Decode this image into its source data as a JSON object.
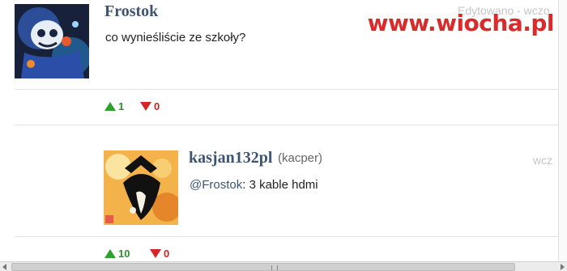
{
  "watermark": "www.wiocha.pl",
  "comments": [
    {
      "username": "Frostok",
      "text": "co wynieśliście ze szkoły?",
      "edited_label": "Edytowano",
      "time_fragment": "wczo",
      "upvotes": "1",
      "downvotes": "0"
    },
    {
      "username": "kasjan132pl",
      "display_name": "(kacper)",
      "mention": "@Frostok",
      "text": ": 3 kable hdmi",
      "time_fragment": "wcz",
      "upvotes": "10",
      "downvotes": "0"
    }
  ],
  "icons": {
    "upvote": "triangle-up-icon",
    "downvote": "triangle-down-icon"
  },
  "colors": {
    "username": "#3d5473",
    "upvote": "#2ea02e",
    "downvote": "#d42626",
    "watermark": "#d92b2b"
  }
}
